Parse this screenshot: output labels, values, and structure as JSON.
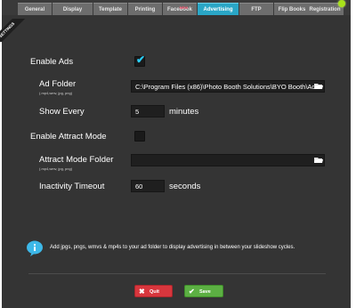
{
  "tabs": [
    {
      "label": "General"
    },
    {
      "label": "Display"
    },
    {
      "label": "Template"
    },
    {
      "label": "Printing"
    },
    {
      "label": "Facebook",
      "badge": "NEW"
    },
    {
      "label": "Advertising",
      "active": true
    },
    {
      "label": "FTP"
    },
    {
      "label": "Flip Books"
    },
    {
      "label": "Registration"
    }
  ],
  "corner": {
    "key": "F1",
    "label": "SETTINGS"
  },
  "enable_ads": {
    "label": "Enable Ads",
    "checked": true
  },
  "ad_folder": {
    "label": "Ad Folder",
    "sublabel": "(.mp4,wmv, jpg, png)",
    "value": "C:\\Program Files (x86)\\Photo Booth Solutions\\BYO Booth\\Ads"
  },
  "show_every": {
    "label": "Show Every",
    "value": "5",
    "unit": "minutes"
  },
  "enable_attract": {
    "label": "Enable Attract Mode",
    "checked": false
  },
  "attract_folder": {
    "label": "Attract Mode Folder",
    "sublabel": "(.mp4,wmv, jpg, png)",
    "value": ""
  },
  "inactivity": {
    "label": "Inactivity Timeout",
    "value": "60",
    "unit": "seconds"
  },
  "info": {
    "text": "Add jpgs, pngs, wmvs & mp4s to your ad folder to display advertising in between your slideshow cycles."
  },
  "buttons": {
    "quit": "Quit",
    "save": "Save"
  },
  "colors": {
    "accent": "#2aa6c6",
    "panel": "#343434",
    "quit": "#d8363d",
    "save": "#5cb043"
  }
}
